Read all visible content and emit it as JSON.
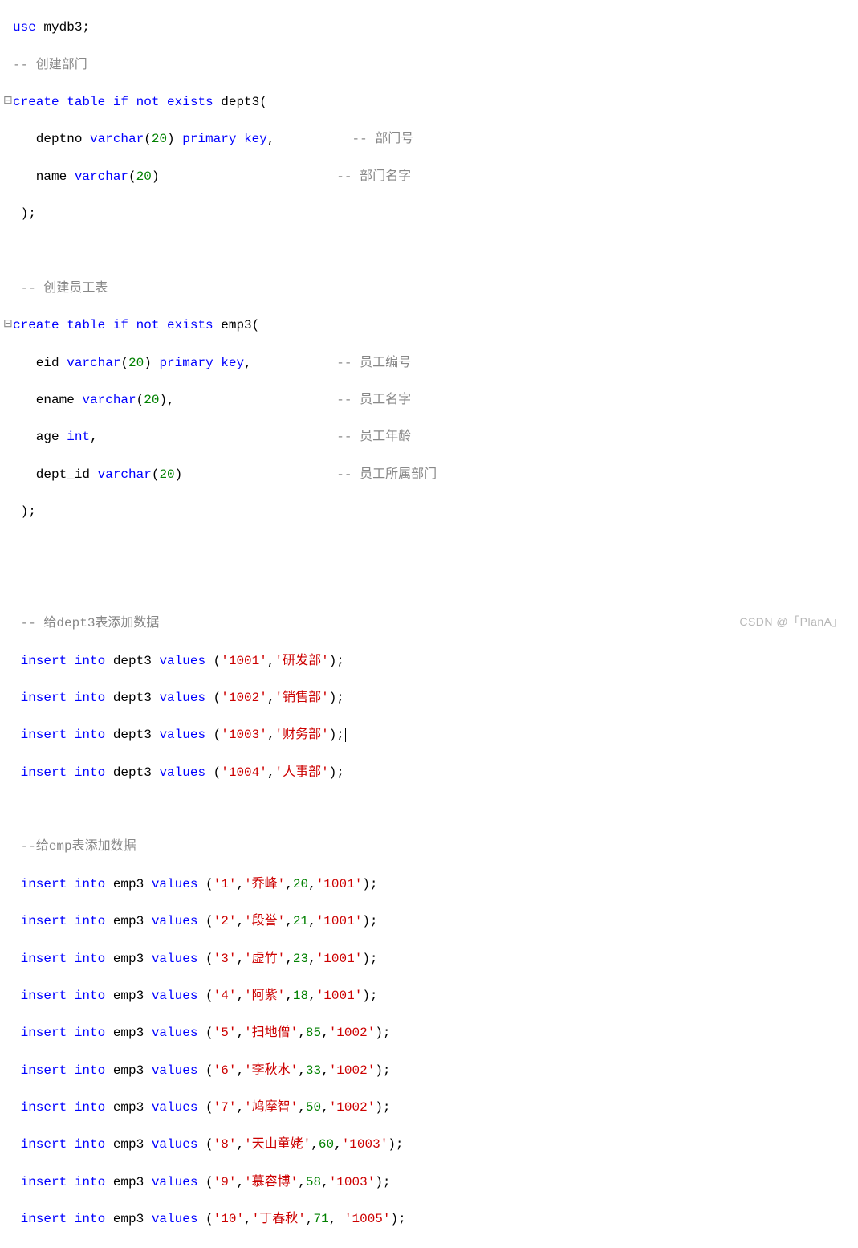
{
  "fold_marker": "⊟",
  "watermark": "CSDN @「PlanA」",
  "lines": {
    "l01_use": "use",
    "l01_db": " mydb3",
    "l01_end": ";",
    "l02": "-- 创建部门",
    "l03_create": "create table if not exists",
    "l03_name": " dept3(",
    "l04a": "   deptno ",
    "l04b": "varchar",
    "l04c": "(",
    "l04num": "20",
    "l04d": ") ",
    "l04e": "primary key",
    "l04f": ",",
    "l04g": "          -- 部门号",
    "l05a": "   name ",
    "l05b": "varchar",
    "l05c": "(",
    "l05num": "20",
    "l05d": ")",
    "l05e": "                       -- 部门名字",
    "l06": " );",
    "l07": " ",
    "l08": " -- 创建员工表",
    "l09_create": "create table if not exists",
    "l09_name": " emp3(",
    "l10a": "   eid ",
    "l10b": "varchar",
    "l10c": "(",
    "l10num": "20",
    "l10d": ") ",
    "l10e": "primary key",
    "l10f": ",",
    "l10g": "           -- 员工编号",
    "l11a": "   ename ",
    "l11b": "varchar",
    "l11c": "(",
    "l11num": "20",
    "l11d": "),",
    "l11e": "                     -- 员工名字",
    "l12a": "   age ",
    "l12b": "int",
    "l12c": ",",
    "l12d": "                               -- 员工年龄",
    "l13a": "   dept_id ",
    "l13b": "varchar",
    "l13c": "(",
    "l13num": "20",
    "l13d": ")",
    "l13e": "                    -- 员工所属部门",
    "l14": " );",
    "l15": " ",
    "l16": " ",
    "l17": " -- 给dept3表添加数据",
    "d1a": " insert into",
    "d1b": " dept3 ",
    "d1c": "values",
    "d1d": " (",
    "d1s1": "'1001'",
    "d1e": ",",
    "d1s2": "'研发部'",
    "d1f": ");",
    "d2s1": "'1002'",
    "d2s2": "'销售部'",
    "d3s1": "'1003'",
    "d3s2": "'财务部'",
    "d4s1": "'1004'",
    "d4s2": "'人事部'",
    "l22": " ",
    "l23": " --给emp表添加数据",
    "e_ins": " insert into",
    "e_tbl": " emp3 ",
    "e_val": "values",
    "e_op": " (",
    "comma": ",",
    "paren_close": ");",
    "paren_close_sp": ");",
    "e1_1": "'1'",
    "e1_2": "'乔峰'",
    "e1_3": "20",
    "e1_4": "'1001'",
    "e2_1": "'2'",
    "e2_2": "'段誉'",
    "e2_3": "21",
    "e2_4": "'1001'",
    "e3_1": "'3'",
    "e3_2": "'虚竹'",
    "e3_3": "23",
    "e3_4": "'1001'",
    "e4_1": "'4'",
    "e4_2": "'阿紫'",
    "e4_3": "18",
    "e4_4": "'1001'",
    "e5_1": "'5'",
    "e5_2": "'扫地僧'",
    "e5_3": "85",
    "e5_4": "'1002'",
    "e6_1": "'6'",
    "e6_2": "'李秋水'",
    "e6_3": "33",
    "e6_4": "'1002'",
    "e7_1": "'7'",
    "e7_2": "'鸠摩智'",
    "e7_3": "50",
    "e7_4": "'1002'",
    "e8_1": "'8'",
    "e8_2": "'天山童姥'",
    "e8_3": "60",
    "e8_4": "'1003'",
    "e9_1": "'9'",
    "e9_2": "'慕容博'",
    "e9_3": "58",
    "e9_4": "'1003'",
    "e10_1": "'10'",
    "e10_2": "'丁春秋'",
    "e10_3": "71",
    "e10_4sp": " '1005'"
  }
}
